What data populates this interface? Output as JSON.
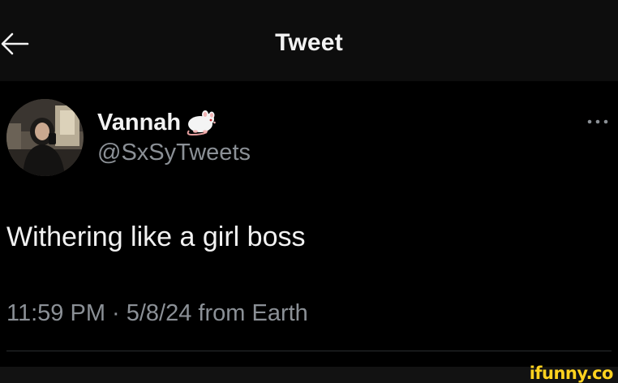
{
  "header": {
    "title": "Tweet",
    "back_icon": "arrow-left-icon"
  },
  "author": {
    "display_name": "Vannah",
    "emoji": "rat",
    "handle": "@SxSyTweets"
  },
  "tweet": {
    "text": "Withering like a girl boss",
    "timestamp": "11:59 PM · 5/8/24 from Earth"
  },
  "more_icon": "ellipsis-icon",
  "watermark": "ifunny.co",
  "colors": {
    "background": "#000000",
    "header_bg": "#0d0d0d",
    "text_primary": "#f2f2f2",
    "text_secondary": "#8b9096",
    "divider": "#2a2d30",
    "watermark": "#ffd21f"
  }
}
